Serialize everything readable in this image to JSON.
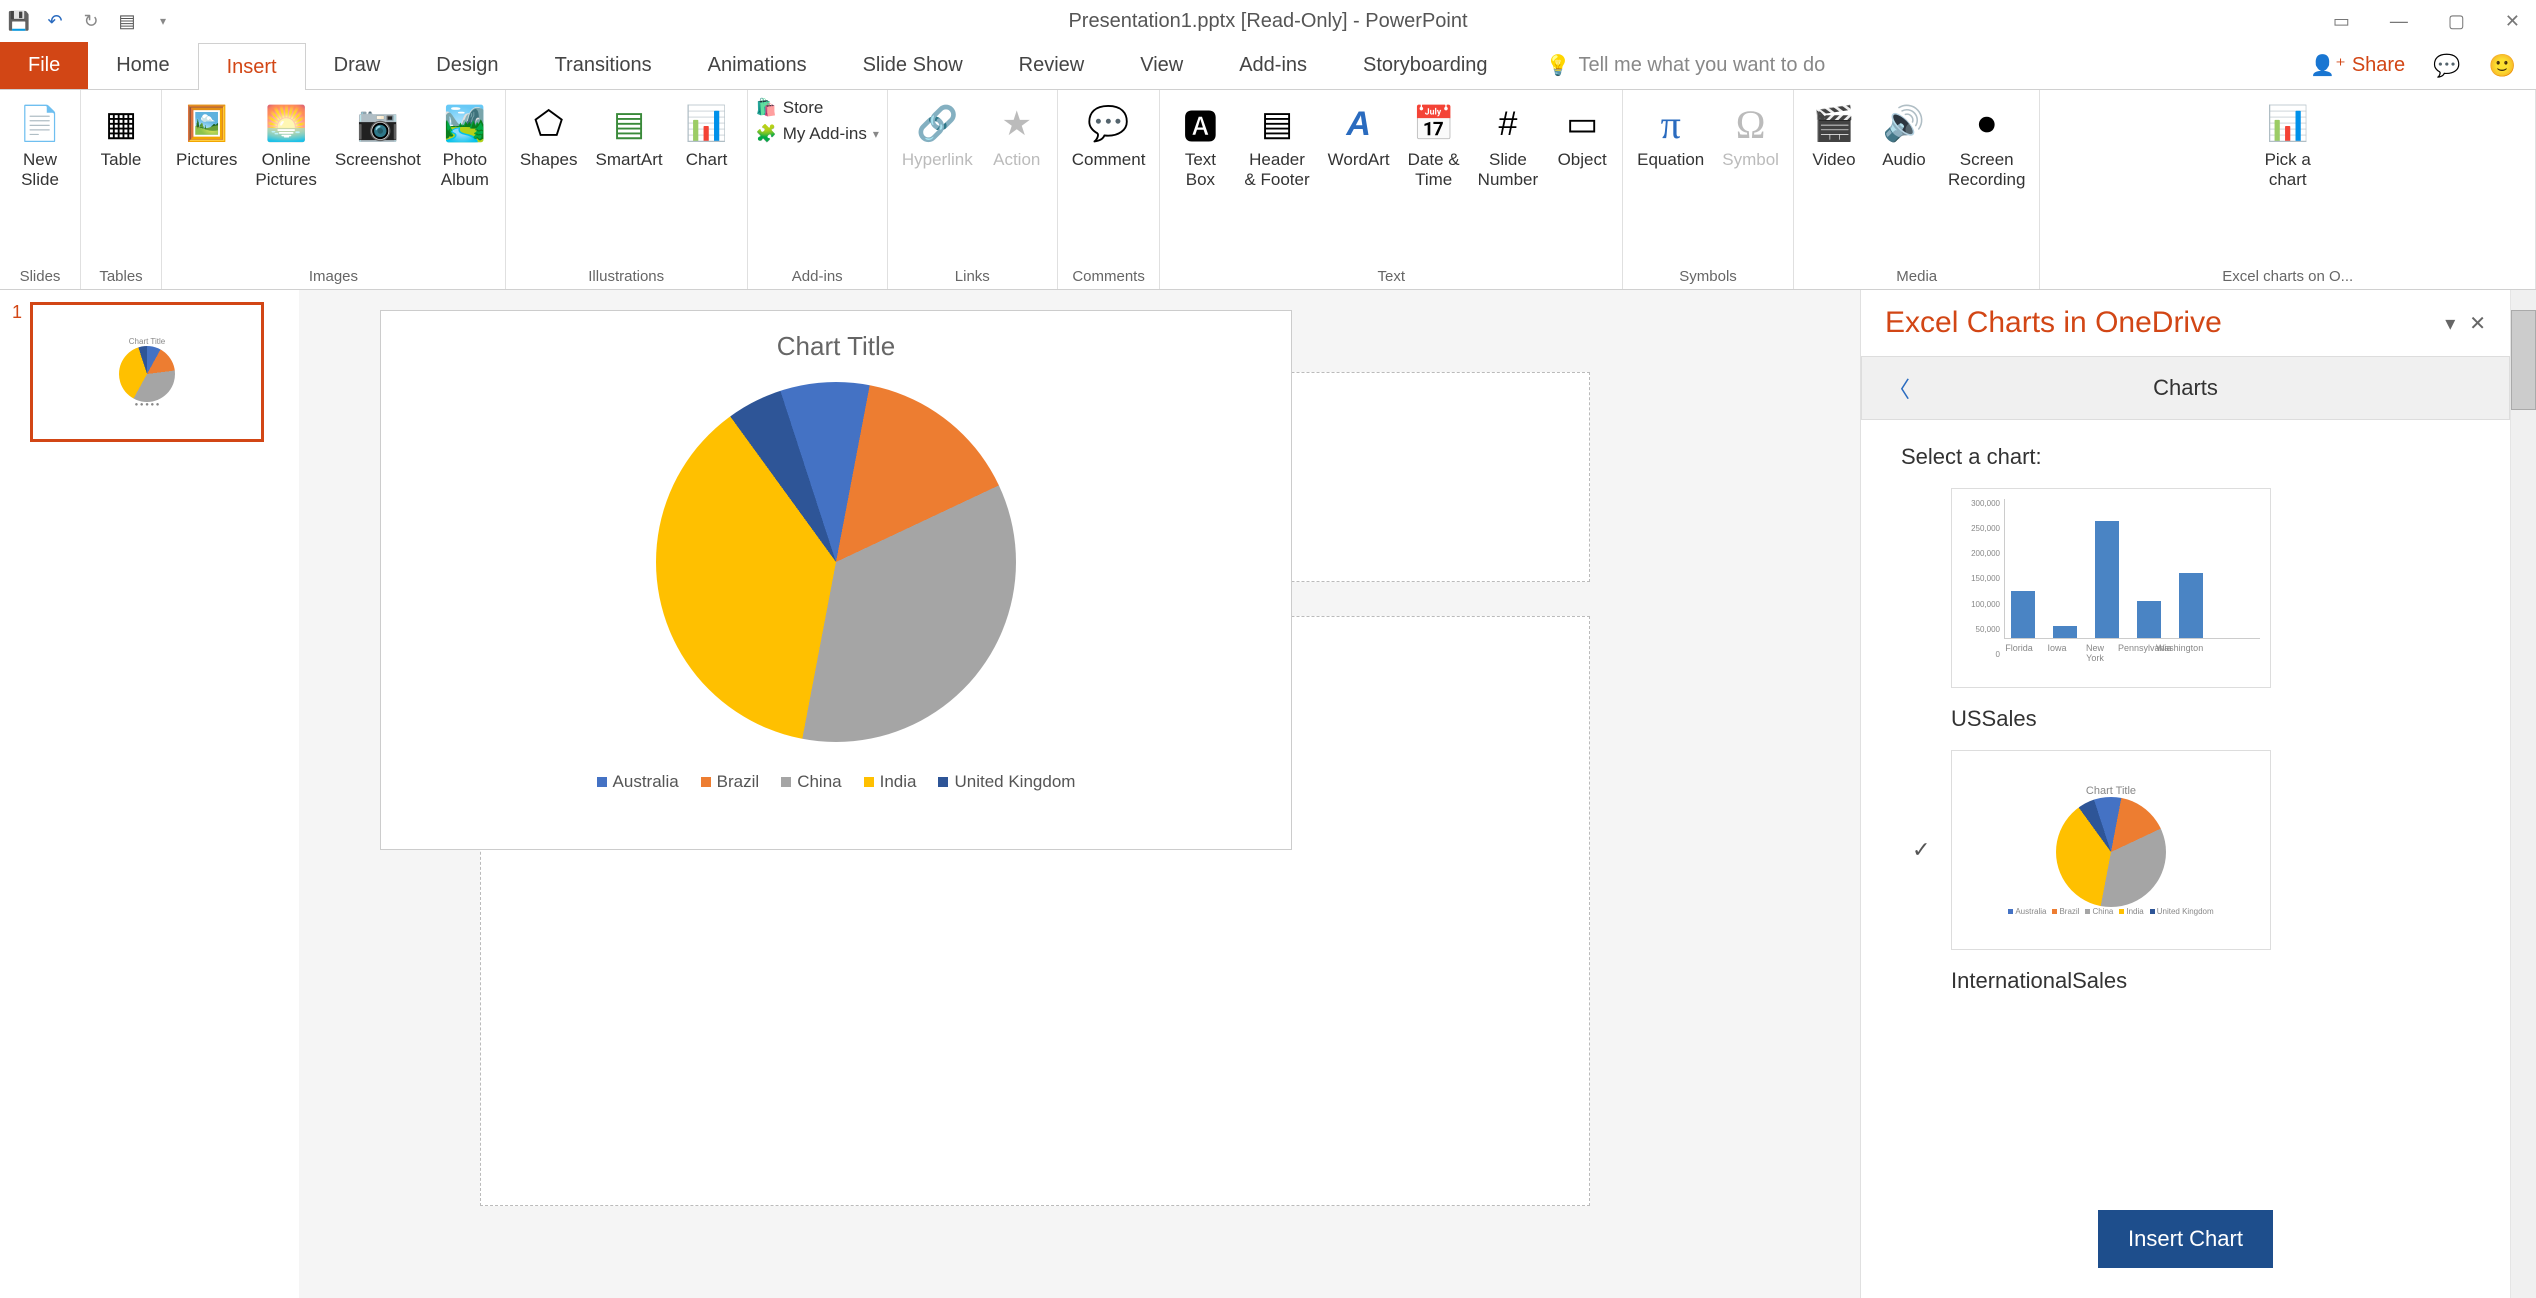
{
  "title": "Presentation1.pptx [Read-Only] - PowerPoint",
  "tabs": {
    "file": "File",
    "home": "Home",
    "insert": "Insert",
    "draw": "Draw",
    "design": "Design",
    "transitions": "Transitions",
    "animations": "Animations",
    "slideshow": "Slide Show",
    "review": "Review",
    "view": "View",
    "addins": "Add-ins",
    "storyboarding": "Storyboarding"
  },
  "tellme": "Tell me what you want to do",
  "share": "Share",
  "ribbon": {
    "slides": {
      "new_slide": "New\nSlide",
      "group": "Slides"
    },
    "tables": {
      "table": "Table",
      "group": "Tables"
    },
    "images": {
      "pictures": "Pictures",
      "online_pictures": "Online\nPictures",
      "screenshot": "Screenshot",
      "photo_album": "Photo\nAlbum",
      "group": "Images"
    },
    "illustrations": {
      "shapes": "Shapes",
      "smartart": "SmartArt",
      "chart": "Chart",
      "group": "Illustrations"
    },
    "addins": {
      "store": "Store",
      "myaddins": "My Add-ins",
      "group": "Add-ins"
    },
    "links": {
      "hyperlink": "Hyperlink",
      "action": "Action",
      "group": "Links"
    },
    "comments": {
      "comment": "Comment",
      "group": "Comments"
    },
    "text": {
      "textbox": "Text\nBox",
      "header": "Header\n& Footer",
      "wordart": "WordArt",
      "datetime": "Date &\nTime",
      "slidenum": "Slide\nNumber",
      "object": "Object",
      "group": "Text"
    },
    "symbols": {
      "equation": "Equation",
      "symbol": "Symbol",
      "group": "Symbols"
    },
    "media": {
      "video": "Video",
      "audio": "Audio",
      "screenrec": "Screen\nRecording",
      "group": "Media"
    },
    "excelcharts": {
      "pick": "Pick a\nchart",
      "group": "Excel charts on O..."
    }
  },
  "slide": {
    "number": "1"
  },
  "chart_data": {
    "type": "pie",
    "title": "Chart Title",
    "categories": [
      "Australia",
      "Brazil",
      "China",
      "India",
      "United Kingdom"
    ],
    "values": [
      8,
      15,
      35,
      37,
      5
    ],
    "colors": [
      "#4472c4",
      "#ed7d31",
      "#a5a5a5",
      "#ffc000",
      "#2e5597"
    ]
  },
  "taskpane": {
    "title": "Excel Charts in OneDrive",
    "header": "Charts",
    "select_label": "Select a chart:",
    "chart1_name": "USSales",
    "chart2_name": "InternationalSales",
    "insert_btn": "Insert Chart",
    "bar_thumb": {
      "type": "bar",
      "categories": [
        "Florida",
        "Iowa",
        "New York",
        "Pennsylvania",
        "Washington"
      ],
      "values": [
        100000,
        25000,
        250000,
        80000,
        140000
      ],
      "ylim": [
        0,
        300000
      ],
      "yticks": [
        "0",
        "50,000",
        "100,000",
        "150,000",
        "200,000",
        "250,000",
        "300,000"
      ]
    }
  }
}
